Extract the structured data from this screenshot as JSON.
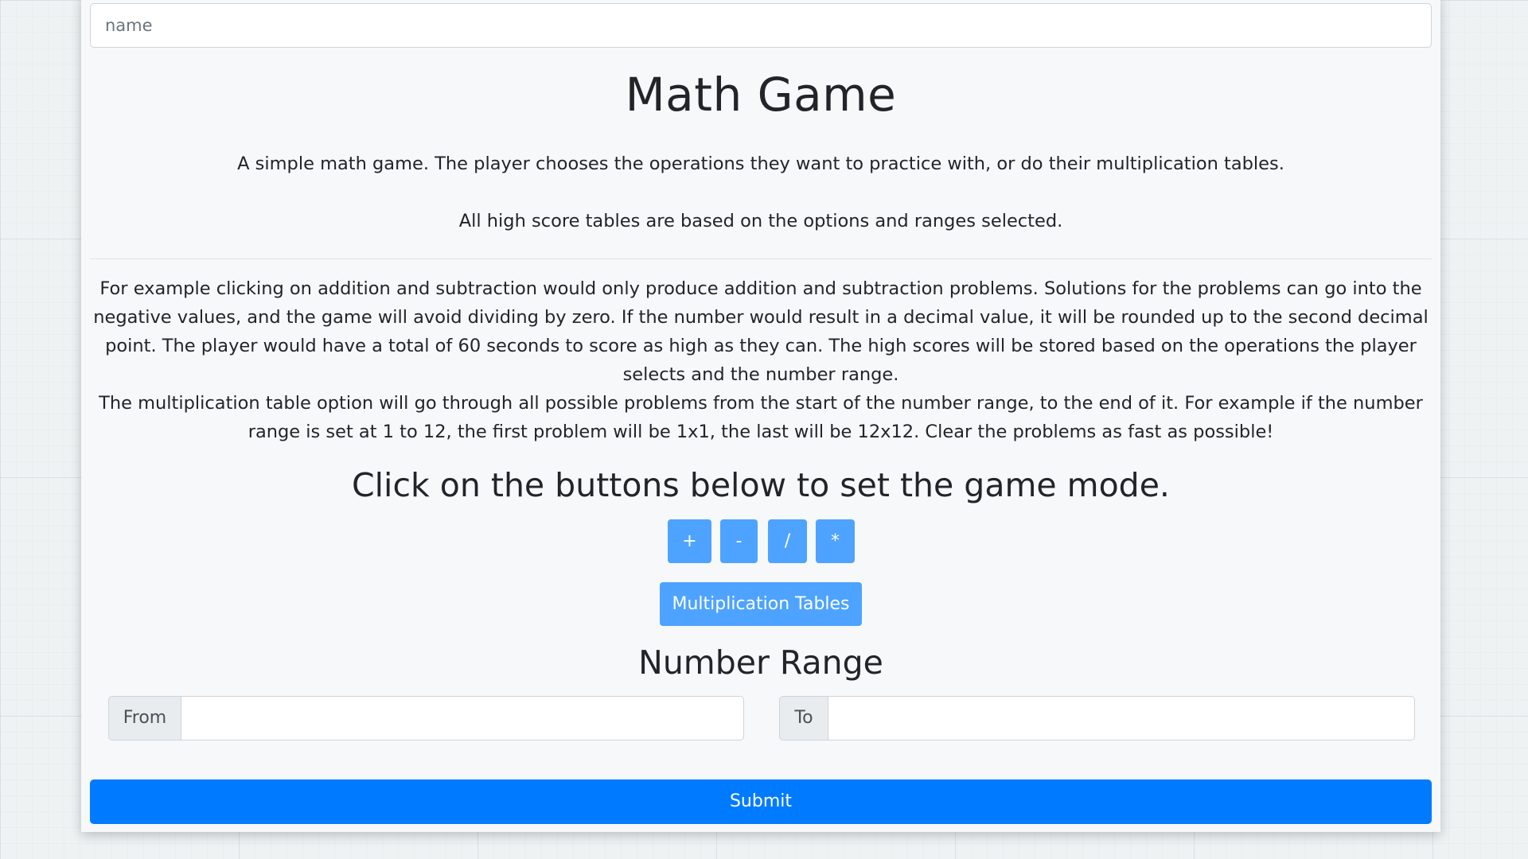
{
  "name_field": {
    "placeholder": "name",
    "value": ""
  },
  "header": {
    "title": "Math Game"
  },
  "intro": {
    "description": "A simple math game. The player chooses the operations they want to practice with, or do their multiplication tables.",
    "high_scores_note": "All high score tables are based on the options and ranges selected."
  },
  "details": {
    "operations_explanation": "For example clicking on addition and subtraction would only produce addition and subtraction problems. Solutions for the problems can go into the negative values, and the game will avoid dividing by zero. If the number would result in a decimal value, it will be rounded up to the second decimal point. The player would have a total of 60 seconds to score as high as they can. The high scores will be stored based on the operations the player selects and the number range.",
    "tables_explanation": "The multiplication table option will go through all possible problems from the start of the number range, to the end of it. For example if the number range is set at 1 to 12, the first problem will be 1x1, the last will be 12x12. Clear the problems as fast as possible!"
  },
  "game_mode": {
    "heading": "Click on the buttons below to set the game mode.",
    "operations": [
      {
        "label": "+"
      },
      {
        "label": "-"
      },
      {
        "label": "/"
      },
      {
        "label": "*"
      }
    ],
    "tables_button": "Multiplication Tables"
  },
  "range": {
    "heading": "Number Range",
    "from_label": "From",
    "from_value": "",
    "to_label": "To",
    "to_value": ""
  },
  "submit_label": "Submit",
  "colors": {
    "mode_button": "#4da3ff",
    "submit_button": "#007bff",
    "card_background": "#f7f8f9"
  }
}
